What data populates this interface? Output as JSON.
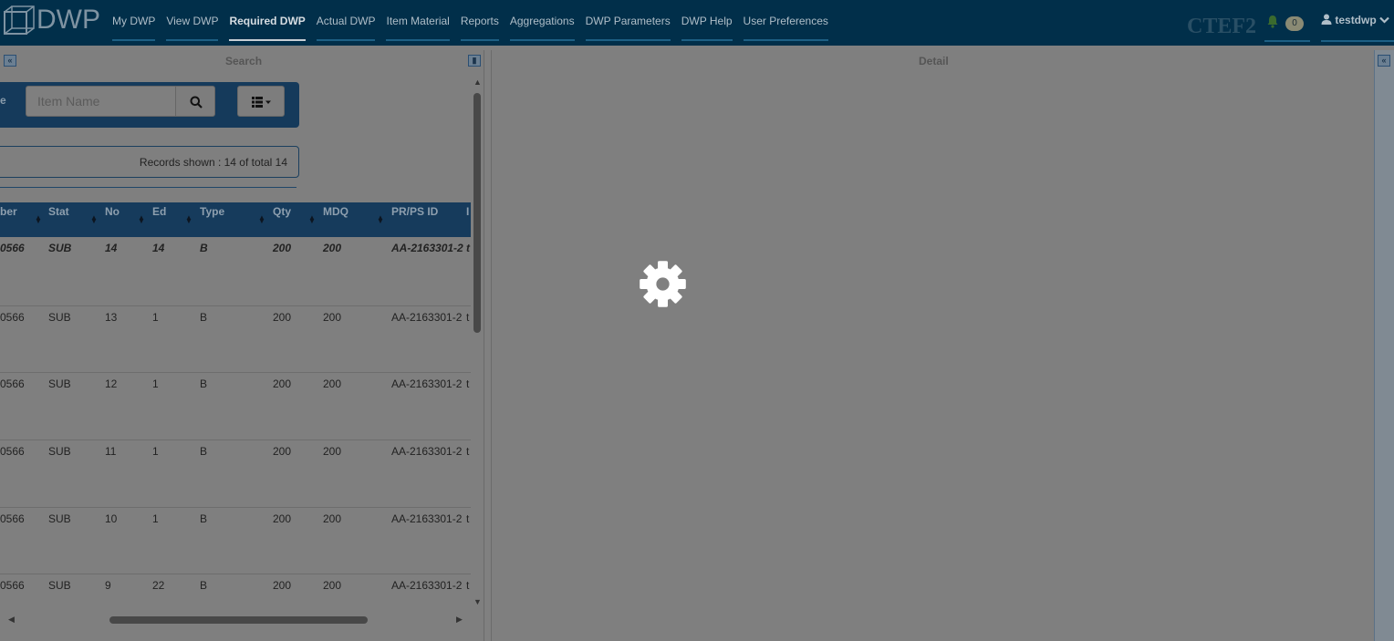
{
  "app": {
    "logo_text": "DWP",
    "environment": "CTEF2"
  },
  "nav": {
    "items": [
      {
        "label": "My DWP",
        "active": false
      },
      {
        "label": "View DWP",
        "active": false
      },
      {
        "label": "Required DWP",
        "active": true
      },
      {
        "label": "Actual DWP",
        "active": false
      },
      {
        "label": "Item Material",
        "active": false
      },
      {
        "label": "Reports",
        "active": false
      },
      {
        "label": "Aggregations",
        "active": false
      },
      {
        "label": "DWP Parameters",
        "active": false
      },
      {
        "label": "DWP Help",
        "active": false
      },
      {
        "label": "User Preferences",
        "active": false
      }
    ],
    "notifications_count": "0",
    "user": "testdwp"
  },
  "search_panel": {
    "title": "Search",
    "cut_label": "e",
    "search_placeholder": "Item Name",
    "records_shown": "Records shown : 14 of total 14",
    "columns": [
      "ber",
      "Stat",
      "No",
      "Ed",
      "Type",
      "Qty",
      "MDQ",
      "PR/PS ID",
      "I"
    ],
    "rows": [
      [
        "0566",
        "SUB",
        "14",
        "14",
        "B",
        "200",
        "200",
        "AA-2163301-2",
        "t"
      ],
      [
        "0566",
        "SUB",
        "13",
        "1",
        "B",
        "200",
        "200",
        "AA-2163301-2",
        "t"
      ],
      [
        "0566",
        "SUB",
        "12",
        "1",
        "B",
        "200",
        "200",
        "AA-2163301-2",
        "t"
      ],
      [
        "0566",
        "SUB",
        "11",
        "1",
        "B",
        "200",
        "200",
        "AA-2163301-2",
        "t"
      ],
      [
        "0566",
        "SUB",
        "10",
        "1",
        "B",
        "200",
        "200",
        "AA-2163301-2",
        "t"
      ],
      [
        "0566",
        "SUB",
        "9",
        "22",
        "B",
        "200",
        "200",
        "AA-2163301-2",
        "t"
      ]
    ]
  },
  "detail_panel": {
    "title": "Detail"
  },
  "icons": {
    "collapse": "double-chevron-left-icon",
    "pin": "pin-icon",
    "search": "search-icon",
    "view": "list-view-icon",
    "loading": "gear-icon",
    "bell": "bell-icon",
    "user": "user-icon"
  },
  "colors": {
    "navbar": "#012f4a",
    "table_header": "#163b5c",
    "overlay_gray": "#808080"
  }
}
